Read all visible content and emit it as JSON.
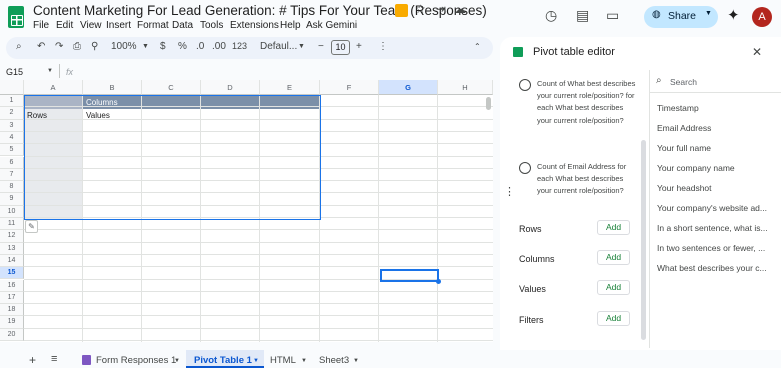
{
  "app": {
    "title": "Content Marketing For Lead Generation: # Tips For Your Team  (Responses)",
    "menu": [
      "File",
      "Edit",
      "View",
      "Insert",
      "Format",
      "Data",
      "Tools",
      "Extensions",
      "Help",
      "Ask Gemini"
    ],
    "share_label": "Share",
    "avatar_letter": "A"
  },
  "toolbar": {
    "zoom": "100%",
    "currency": "$",
    "percent": "%",
    "decrease_decimal": ".0",
    "increase_decimal": ".00",
    "number_format": "123",
    "font": "Defaul...",
    "font_size": "10"
  },
  "formula_bar": {
    "cell_ref": "G15",
    "fx": "fx"
  },
  "grid": {
    "columns": [
      "A",
      "B",
      "C",
      "D",
      "E",
      "F",
      "G",
      "H"
    ],
    "rows": [
      "1",
      "2",
      "3",
      "4",
      "5",
      "6",
      "7",
      "8",
      "9",
      "10",
      "11",
      "12",
      "13",
      "14",
      "15",
      "16",
      "17",
      "18",
      "19",
      "20"
    ],
    "pivot": {
      "columns_label": "Columns",
      "rows_label": "Rows",
      "values_label": "Values"
    },
    "selected_cell": "G15"
  },
  "sheet_tabs": [
    "Form Responses 1",
    "Pivot Table 1",
    "HTML",
    "Sheet3"
  ],
  "active_tab": "Pivot Table 1",
  "pivot_editor": {
    "title": "Pivot table editor",
    "suggestions": [
      "Count of What best describes your current role/position? for each What best describes your current role/position?",
      "Count of Email Address for each What best describes your current role/position?"
    ],
    "sections": [
      {
        "label": "Rows",
        "button": "Add"
      },
      {
        "label": "Columns",
        "button": "Add"
      },
      {
        "label": "Values",
        "button": "Add"
      },
      {
        "label": "Filters",
        "button": "Add"
      }
    ],
    "search_placeholder": "Search",
    "fields": [
      "Timestamp",
      "Email Address",
      "Your full name",
      "Your company name",
      "Your headshot",
      "Your company's website ad...",
      "In a short sentence, what is...",
      "In two sentences or fewer, ...",
      "What best describes your c..."
    ]
  }
}
